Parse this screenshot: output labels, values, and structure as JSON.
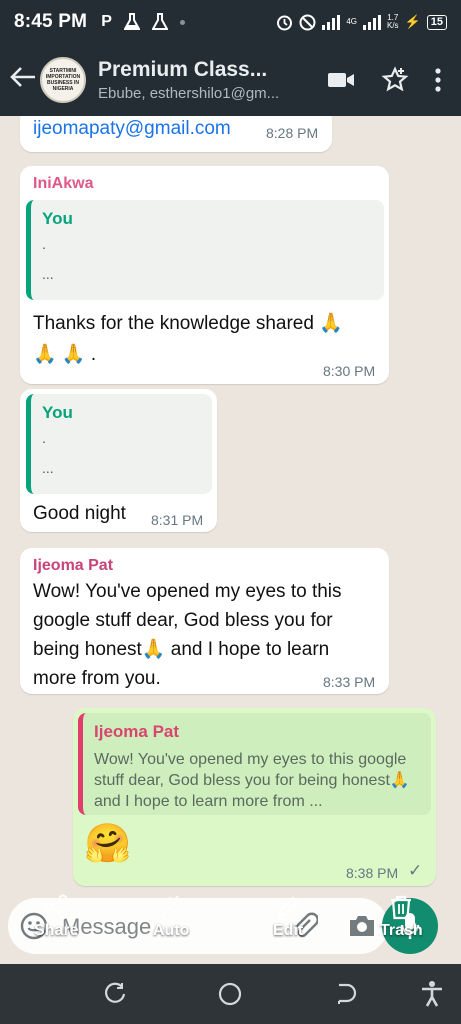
{
  "status_bar": {
    "time": "8:45 PM",
    "left_icons": [
      "parking-icon",
      "flask-icon",
      "flask-icon"
    ],
    "network": "4G",
    "speed_top": "1.7",
    "speed_bottom": "K/s",
    "battery": "15"
  },
  "header": {
    "avatar_text": "STARTMINI IMPORTATION BUSINESS IN NIGERIA",
    "title": "Premium Class...",
    "subtitle": "Ebube, esthershilo1@gm..."
  },
  "messages": [
    {
      "text": "ijeomapaty@gmail.com",
      "time": "8:28 PM"
    },
    {
      "sender": "IniAkwa",
      "quote": {
        "name": "You",
        "line1": ".",
        "line2": "..."
      },
      "text_line1": "Thanks for the knowledge shared 🙏",
      "text_line2": "🙏 🙏 .",
      "time": "8:30 PM"
    },
    {
      "quote": {
        "name": "You",
        "line1": ".",
        "line2": "..."
      },
      "text": "Good night",
      "time": "8:31 PM"
    },
    {
      "sender": "Ijeoma Pat",
      "lines": [
        "Wow! You've opened my eyes to this",
        "google stuff dear, God bless you for",
        "being honest🙏 and I hope to learn",
        "more from you."
      ],
      "time": "8:33 PM"
    },
    {
      "quote": {
        "name": "Ijeoma Pat",
        "text": "Wow! You've opened my eyes to this google stuff dear, God bless you for being honest🙏 and I hope to learn more from ..."
      },
      "emoji": "🤗",
      "time": "8:38 PM",
      "tick": "✓"
    }
  ],
  "composer": {
    "placeholder": "Message",
    "tools": [
      {
        "label": "Share",
        "icon": "share-icon"
      },
      {
        "label": "Auto",
        "icon": "magic-wand-icon"
      },
      {
        "label": "Edit",
        "icon": "pencil-icon"
      },
      {
        "label": "Trash",
        "icon": "trash-icon"
      }
    ]
  },
  "colors": {
    "header_bg": "#232d33",
    "chat_bg": "#ece5dd",
    "outgoing_bubble": "#dcf8c6",
    "accent_green": "#128c6e",
    "sender_pink": "#e0578a",
    "quote_green": "#06a37c"
  }
}
